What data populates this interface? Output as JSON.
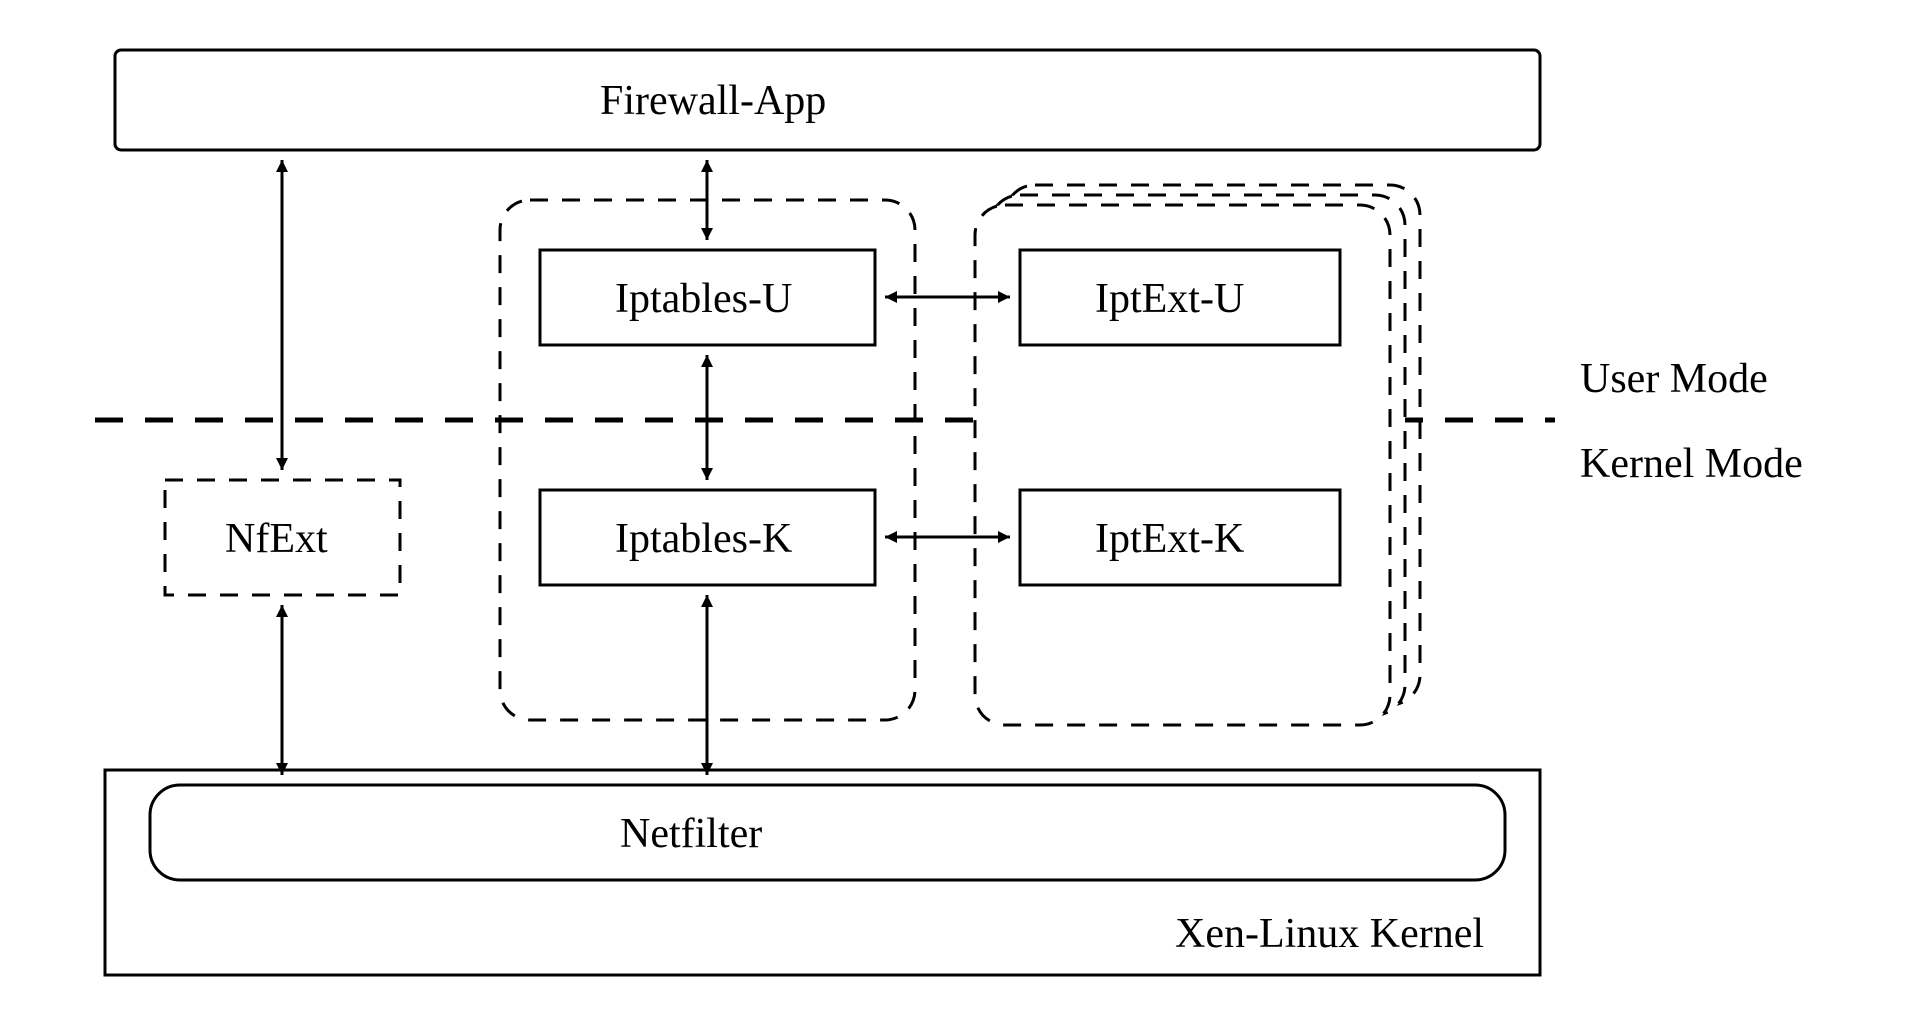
{
  "blocks": {
    "firewall_app": "Firewall-App",
    "iptables_u": "Iptables-U",
    "iptables_k": "Iptables-K",
    "iptext_u": "IptExt-U",
    "iptext_k": "IptExt-K",
    "nfext": "NfExt",
    "netfilter": "Netfilter",
    "xen_kernel": "Xen-Linux Kernel"
  },
  "modes": {
    "user": "User Mode",
    "kernel": "Kernel Mode"
  }
}
